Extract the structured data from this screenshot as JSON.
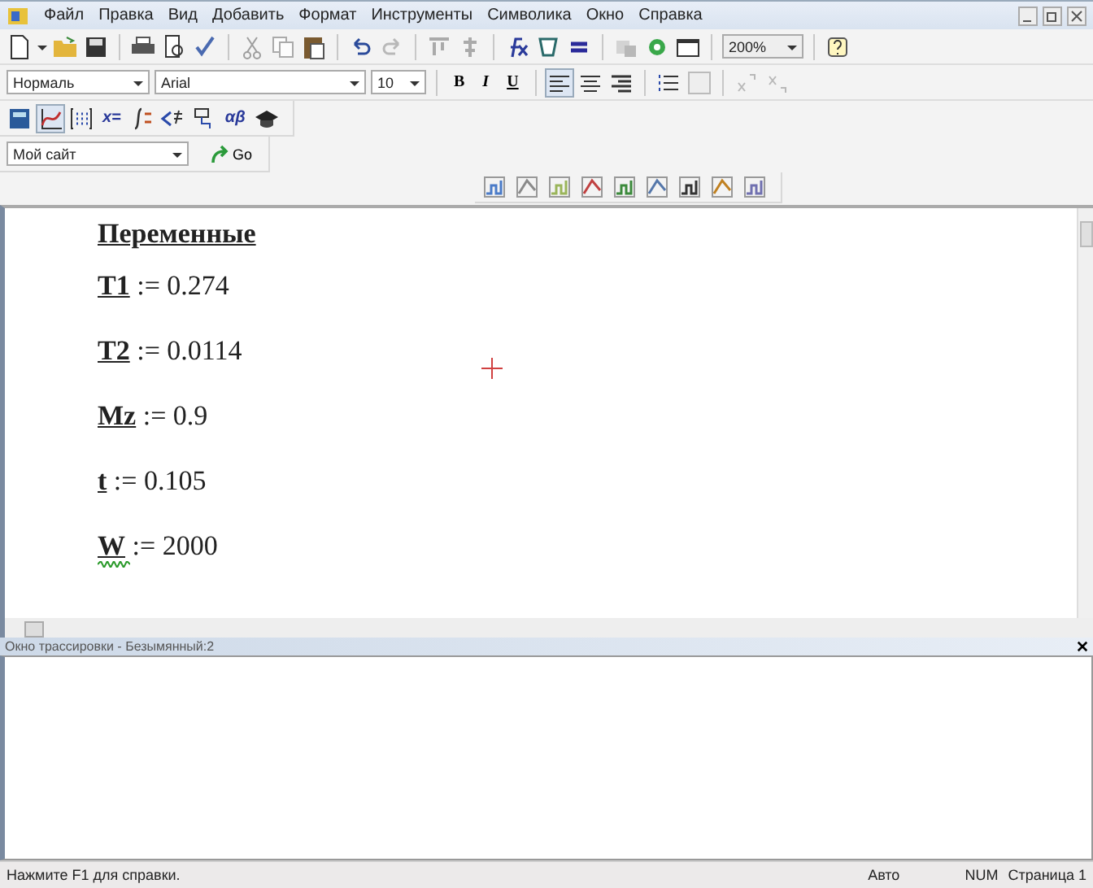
{
  "menu": [
    "Файл",
    "Правка",
    "Вид",
    "Добавить",
    "Формат",
    "Инструменты",
    "Символика",
    "Окно",
    "Справка"
  ],
  "toolbar": {
    "zoom": "200%"
  },
  "format_bar": {
    "style": "Нормаль",
    "font": "Arial",
    "size": "10",
    "buttons": [
      "B",
      "I",
      "U"
    ]
  },
  "math_palette": [
    {
      "kind": "calculator",
      "selected": false
    },
    {
      "kind": "graph",
      "selected": true
    },
    {
      "kind": "matrix",
      "selected": false
    },
    {
      "kind": "text",
      "label": "x=",
      "selected": false
    },
    {
      "kind": "calculus",
      "selected": false
    },
    {
      "kind": "boolean",
      "selected": false
    },
    {
      "kind": "programming",
      "selected": false
    },
    {
      "kind": "text",
      "label": "αβ",
      "selected": false
    },
    {
      "kind": "symbolic",
      "selected": false
    }
  ],
  "address_bar": {
    "value": "Мой сайт",
    "go": "Go"
  },
  "worksheet": {
    "heading": "Переменные",
    "definitions": [
      {
        "name": "T1",
        "operator": ":=",
        "value": "0.274",
        "warning": false
      },
      {
        "name": "T2",
        "operator": ":=",
        "value": "0.0114",
        "warning": false
      },
      {
        "name": "Mz",
        "operator": ":=",
        "value": "0.9",
        "warning": false
      },
      {
        "name": "t",
        "operator": ":=",
        "value": "0.105",
        "warning": false
      },
      {
        "name": "W",
        "operator": ":=",
        "value": "2000",
        "warning": true
      }
    ]
  },
  "trace_window": {
    "title": "Окно трассировки - Безымянный:2"
  },
  "status_bar": {
    "hint": "Нажмите F1 для справки.",
    "mode": "Авто",
    "num": "NUM",
    "page": "Страница 1"
  }
}
